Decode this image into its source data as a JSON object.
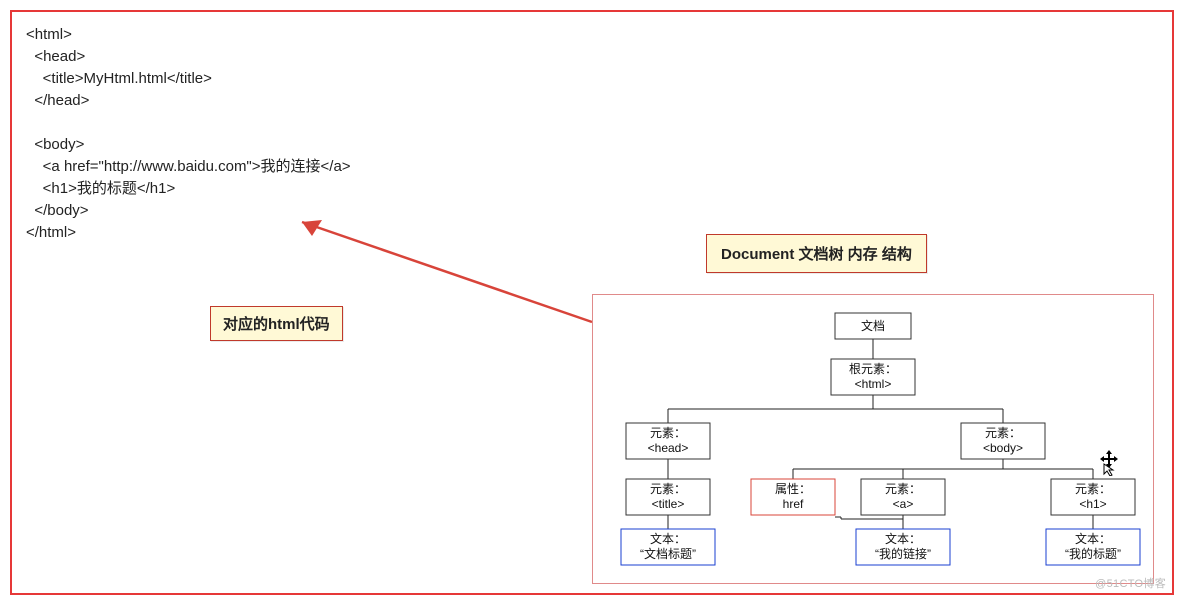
{
  "code": {
    "l1": "<html>",
    "l2": "  <head>",
    "l3": "    <title>MyHtml.html</title>",
    "l4": "  </head>",
    "l5": "",
    "l6": "  <body>",
    "l7": "    <a href=\"http://www.baidu.com\">我的连接</a>",
    "l8": "    <h1>我的标题</h1>",
    "l9": "  </body>",
    "l10": "</html>"
  },
  "callouts": {
    "left": "对应的html代码",
    "right": "Document 文档树 内存 结构"
  },
  "tree": {
    "doc": "文档",
    "root_l1": "根元素：",
    "root_l2": "<html>",
    "head_l1": "元素：",
    "head_l2": "<head>",
    "body_l1": "元素：",
    "body_l2": "<body>",
    "title_l1": "元素：",
    "title_l2": "<title>",
    "href_l1": "属性：",
    "href_l2": "href",
    "a_l1": "元素：",
    "a_l2": "<a>",
    "h1_l1": "元素：",
    "h1_l2": "<h1>",
    "text1_l1": "文本：",
    "text1_l2": "“文档标题”",
    "text2_l1": "文本：",
    "text2_l2": "“我的链接”",
    "text3_l1": "文本：",
    "text3_l2": "“我的标题”"
  },
  "watermark": "@51CTO博客"
}
